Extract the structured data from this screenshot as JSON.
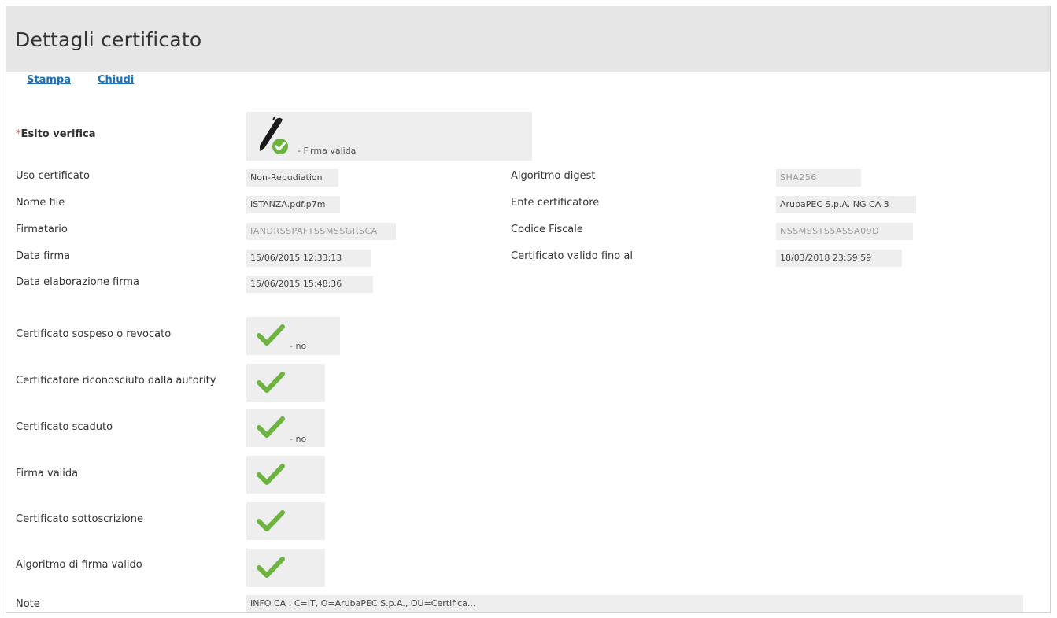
{
  "header": {
    "title": "Dettagli certificato"
  },
  "actions": {
    "print_label": "Stampa",
    "close_label": "Chiudi"
  },
  "esito": {
    "required_mark": "*",
    "label": "Esito verifica",
    "value": "- Firma valida"
  },
  "left_fields": [
    {
      "label": "Uso certificato",
      "value": "Non-Repudiation"
    },
    {
      "label": "Nome file",
      "value": "ISTANZA.pdf.p7m"
    },
    {
      "label": "Firmatario",
      "value": "IANDRSSPAFTSSMSSGRSCA"
    },
    {
      "label": "Data firma",
      "value": "15/06/2015 12:33:13"
    },
    {
      "label": "Data elaborazione firma",
      "value": "15/06/2015 15:48:36"
    }
  ],
  "right_fields": [
    {
      "label": "Algoritmo digest",
      "value": "SHA256"
    },
    {
      "label": "Ente certificatore",
      "value": "ArubaPEC S.p.A. NG CA 3"
    },
    {
      "label": "Codice Fiscale",
      "value": "NSSMSSTS5ASSA09D"
    },
    {
      "label": "Certificato valido fino al",
      "value": "18/03/2018 23:59:59"
    }
  ],
  "checks": [
    {
      "label": "Certificato sospeso o revocato",
      "suffix": "- no"
    },
    {
      "label": "Certificatore riconosciuto dalla autority",
      "suffix": ""
    },
    {
      "label": "Certificato scaduto",
      "suffix": "- no"
    },
    {
      "label": "Firma valida",
      "suffix": ""
    },
    {
      "label": "Certificato sottoscrizione",
      "suffix": ""
    },
    {
      "label": "Algoritmo di firma valido",
      "suffix": ""
    }
  ],
  "note": {
    "label": "Note",
    "value": "INFO CA : C=IT, O=ArubaPEC S.p.A., OU=Certifica..."
  },
  "colors": {
    "header_bg": "#e6e6e6",
    "link": "#1f6fb5",
    "check": "#6db33f",
    "field_bg": "#eeeeee",
    "required": "#d9534f"
  },
  "icons": {
    "esito": "pen-check-icon",
    "checks": "checkmark-icon"
  }
}
